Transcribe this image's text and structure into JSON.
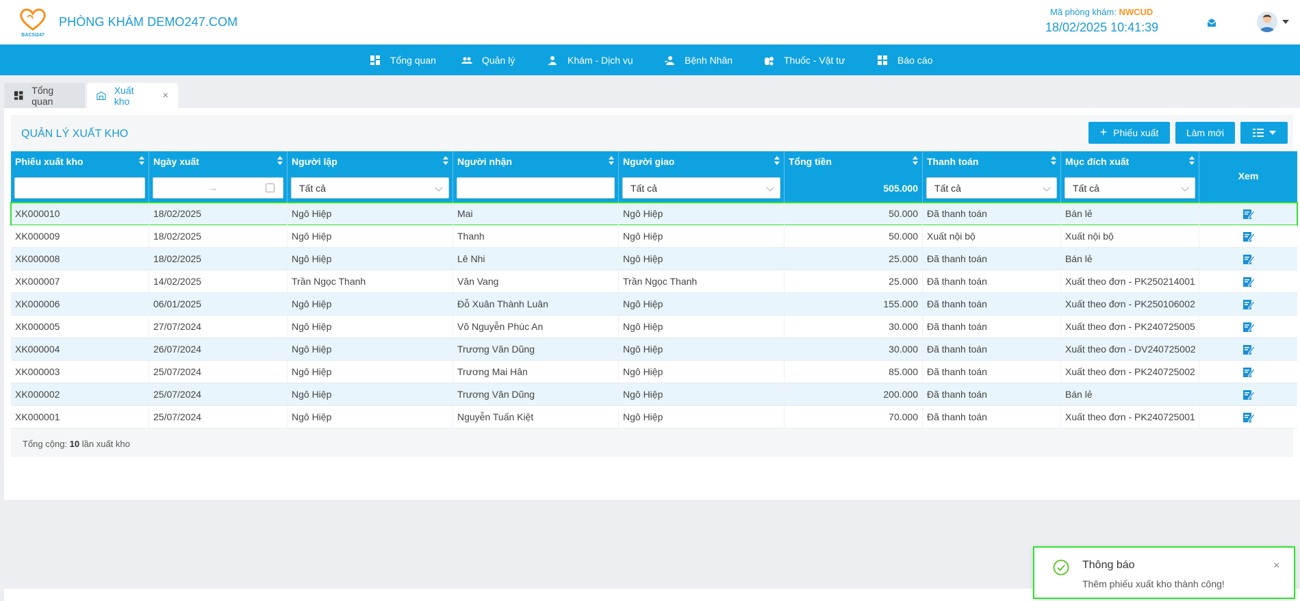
{
  "header": {
    "clinic_name": "PHÒNG KHÁM DEMO247.COM",
    "logo_text": "BACSI247",
    "code_label": "Mã phòng khám:",
    "code_value": "NWCUD",
    "datetime": "18/02/2025 10:41:39"
  },
  "nav": {
    "items": [
      {
        "label": "Tổng quan",
        "icon": "dashboard-icon"
      },
      {
        "label": "Quản lý",
        "icon": "users-icon"
      },
      {
        "label": "Khám - Dịch vụ",
        "icon": "doctor-icon"
      },
      {
        "label": "Bệnh Nhân",
        "icon": "patient-icon"
      },
      {
        "label": "Thuốc - Vật tư",
        "icon": "pills-icon"
      },
      {
        "label": "Báo cáo",
        "icon": "report-icon"
      }
    ]
  },
  "tabs": [
    {
      "label": "Tổng quan"
    },
    {
      "label": "Xuất kho"
    }
  ],
  "page": {
    "title": "QUẢN LÝ XUẤT KHO",
    "new_button": "Phiếu xuất",
    "refresh_button": "Làm mới"
  },
  "table": {
    "columns": [
      "Phiếu xuất kho",
      "Ngày xuất",
      "Người lập",
      "Người nhận",
      "Người giao",
      "Tổng tiền",
      "Thanh toán",
      "Mục đích xuất",
      "Xem"
    ],
    "filters": {
      "nguoi_lap": "Tất cả",
      "nguoi_giao": "Tất cả",
      "tong_tien": "505.000",
      "thanh_toan": "Tất cả",
      "muc_dich": "Tất cả"
    },
    "rows": [
      [
        "XK000010",
        "18/02/2025",
        "Ngô Hiệp",
        "Mai",
        "Ngô Hiệp",
        "50.000",
        "Đã thanh toán",
        "Bán lẻ"
      ],
      [
        "XK000009",
        "18/02/2025",
        "Ngô Hiệp",
        "Thanh",
        "Ngô Hiệp",
        "50.000",
        "Xuất nội bộ",
        "Xuất nội bộ"
      ],
      [
        "XK000008",
        "18/02/2025",
        "Ngô Hiệp",
        "Lê Nhi",
        "Ngô Hiệp",
        "25.000",
        "Đã thanh toán",
        "Bán lẻ"
      ],
      [
        "XK000007",
        "14/02/2025",
        "Trần Ngọc Thanh",
        "Văn Vang",
        "Trần Ngọc Thanh",
        "25.000",
        "Đã thanh toán",
        "Xuất theo đơn - PK250214001"
      ],
      [
        "XK000006",
        "06/01/2025",
        "Ngô Hiệp",
        "Đỗ Xuân Thành Luân",
        "Ngô Hiệp",
        "155.000",
        "Đã thanh toán",
        "Xuất theo đơn - PK250106002"
      ],
      [
        "XK000005",
        "27/07/2024",
        "Ngô Hiệp",
        "Võ Nguyễn Phúc An",
        "Ngô Hiệp",
        "30.000",
        "Đã thanh toán",
        "Xuất theo đơn - PK240725005"
      ],
      [
        "XK000004",
        "26/07/2024",
        "Ngô Hiệp",
        "Trương Văn Dũng",
        "Ngô Hiệp",
        "30.000",
        "Đã thanh toán",
        "Xuất theo đơn - DV240725002"
      ],
      [
        "XK000003",
        "25/07/2024",
        "Ngô Hiệp",
        "Trương Mai Hân",
        "Ngô Hiệp",
        "85.000",
        "Đã thanh toán",
        "Xuất theo đơn - PK240725002"
      ],
      [
        "XK000002",
        "25/07/2024",
        "Ngô Hiệp",
        "Trương Văn Dũng",
        "Ngô Hiệp",
        "200.000",
        "Đã thanh toán",
        "Bán lẻ"
      ],
      [
        "XK000001",
        "25/07/2024",
        "Ngô Hiệp",
        "Nguyễn Tuấn Kiệt",
        "Ngô Hiệp",
        "70.000",
        "Đã thanh toán",
        "Xuất theo đơn - PK240725001"
      ]
    ]
  },
  "footer": {
    "prefix": "Tổng cộng:",
    "count": "10",
    "suffix": "lần xuất kho"
  },
  "toast": {
    "title": "Thông báo",
    "message": "Thêm phiếu xuất kho thành công!",
    "icon": "check-circle-icon"
  },
  "colors": {
    "primary": "#0fa2e0",
    "brand_text": "#1a9ad6",
    "code_accent": "#f7931e",
    "row_alt": "#e8f5fc",
    "highlight": "#2ee32e"
  }
}
